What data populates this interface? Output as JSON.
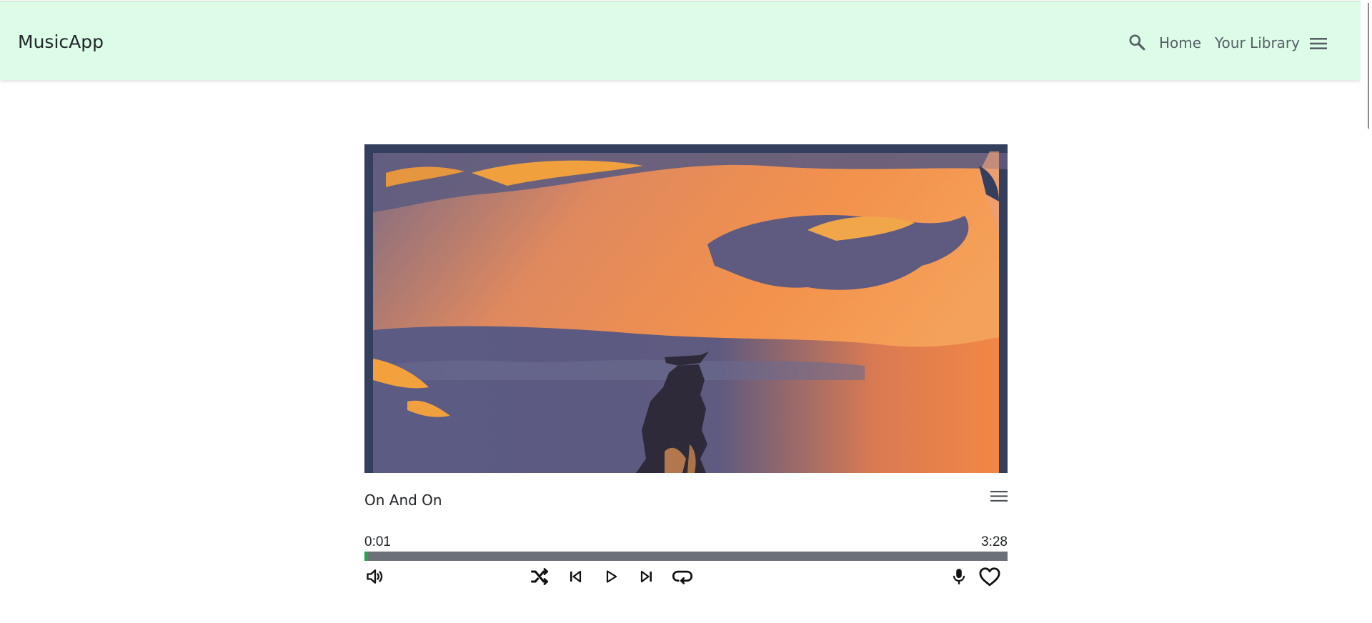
{
  "app": {
    "brand": "MusicApp"
  },
  "nav": {
    "search_icon": "search-icon",
    "links": [
      {
        "label": "Home"
      },
      {
        "label": "Your Library"
      }
    ],
    "menu_icon": "hamburger-menu-icon"
  },
  "player": {
    "title": "On And On",
    "cover_icon": "album-art",
    "queue_icon": "queue-list-icon",
    "time_current": "0:01",
    "time_total": "3:28",
    "progress_fraction": 0.005,
    "controls": {
      "volume": "volume-icon",
      "shuffle": "shuffle-icon",
      "previous": "skip-previous-icon",
      "play": "play-icon",
      "next": "skip-next-icon",
      "repeat": "repeat-icon",
      "lyrics": "microphone-icon",
      "like": "heart-icon"
    }
  },
  "colors": {
    "header_bg": "#dcfce7",
    "progress_track": "#6b7177",
    "progress_fill": "#2ea34f",
    "cover_frame": "#343f5e",
    "cover_orange": "#f08a4b",
    "cover_blue": "#565a80"
  }
}
